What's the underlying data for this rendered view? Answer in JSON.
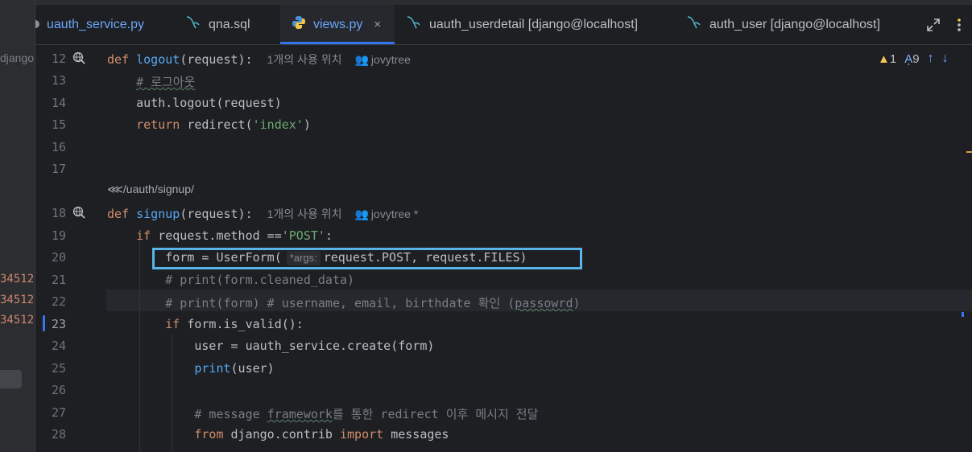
{
  "left_pane": {
    "project_fragment": "django",
    "line_fragments": [
      "34512",
      "34512",
      "34512"
    ]
  },
  "tabs": [
    {
      "label": "uauth_service.py",
      "icon": "python-file-icon",
      "active": false
    },
    {
      "label": "qna.sql",
      "icon": "sql-file-icon",
      "active": false
    },
    {
      "label": "views.py",
      "icon": "python-file-icon",
      "active": true,
      "close": "×"
    },
    {
      "label": "uauth_userdetail [django@localhost]",
      "icon": "db-table-icon",
      "active": false
    },
    {
      "label": "auth_user [django@localhost]",
      "icon": "db-table-icon",
      "active": false
    }
  ],
  "toolbar": {
    "expand_icon": "expand-icon",
    "more_icon": "more-vertical-icon"
  },
  "status": {
    "warnings": "1",
    "typos": "9"
  },
  "gutter": {
    "line_numbers": [
      "12",
      "13",
      "14",
      "15",
      "16",
      "17",
      "18",
      "19",
      "20",
      "21",
      "22",
      "23",
      "24",
      "25",
      "26",
      "27",
      "28"
    ],
    "current_line": "23"
  },
  "route_hint": "/uauth/signup/",
  "hints": {
    "usage": "1개의 사용 위치",
    "author1": "jovytree",
    "author2": "jovytree *",
    "param": "*args:"
  },
  "code": {
    "l12": {
      "kw": "def",
      "fn": "logout",
      "rest": "(request):"
    },
    "l13": "# 로그아웃",
    "l14": "auth.logout(request)",
    "l15": {
      "kw": "return",
      "rest": " redirect(",
      "str": "'index'",
      "end": ")"
    },
    "l18": {
      "kw": "def",
      "fn": "signup",
      "rest": "(request):"
    },
    "l19": {
      "kw": "if",
      "rest": " request.method ==",
      "str": "'POST'",
      "end": ":"
    },
    "l20a": "form = UserForm(",
    "l20b": "request.POST, request.FILES)",
    "l21": "# print(form.cleaned_data)",
    "l22a": "# print(form) # username, email, birthdate 확인 (",
    "l22b": "passowrd",
    "l22c": ")",
    "l23": {
      "kw": "if",
      "rest": " form.is_valid():"
    },
    "l24": "user = uauth_service.create(form)",
    "l25": {
      "fn": "print",
      "rest": "(user)"
    },
    "l27a": "# message ",
    "l27b": "framework",
    "l27c": "를 통한 redirect 이후 메시지 전달",
    "l28": {
      "kw1": "from",
      "mid": " django.contrib ",
      "kw2": "import",
      "rest": " messages"
    }
  }
}
